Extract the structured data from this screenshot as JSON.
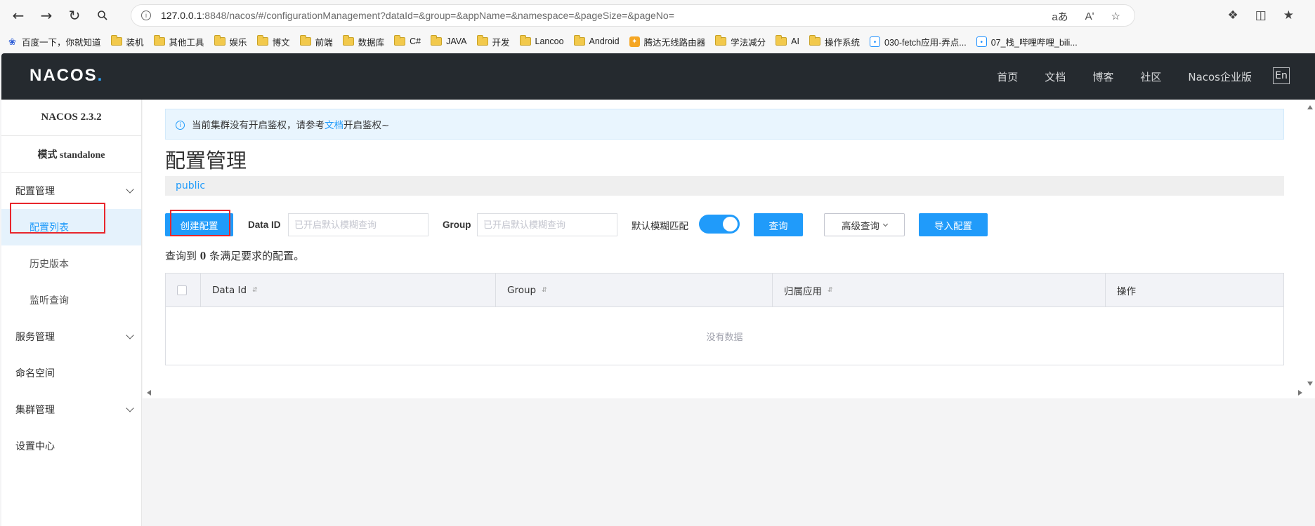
{
  "browser": {
    "url_prefix": "127.0.0.1",
    "url_rest": ":8848/nacos/#/configurationManagement?dataId=&group=&appName=&namespace=&pageSize=&pageNo=",
    "read_aloud": "aあ",
    "text_size": "Aʹ"
  },
  "bookmarks": [
    {
      "label": "百度一下，你就知道",
      "icon": "paw-icon"
    },
    {
      "label": "装机",
      "icon": "folder-icon"
    },
    {
      "label": "其他工具",
      "icon": "folder-icon"
    },
    {
      "label": "娱乐",
      "icon": "folder-icon"
    },
    {
      "label": "博文",
      "icon": "folder-icon"
    },
    {
      "label": "前端",
      "icon": "folder-icon"
    },
    {
      "label": "数据库",
      "icon": "folder-icon"
    },
    {
      "label": "C#",
      "icon": "folder-icon"
    },
    {
      "label": "JAVA",
      "icon": "folder-icon"
    },
    {
      "label": "开发",
      "icon": "folder-icon"
    },
    {
      "label": "Lancoo",
      "icon": "folder-icon"
    },
    {
      "label": "Android",
      "icon": "folder-icon"
    },
    {
      "label": "腾达无线路由器",
      "icon": "router-icon"
    },
    {
      "label": "学法减分",
      "icon": "folder-icon"
    },
    {
      "label": "AI",
      "icon": "folder-icon"
    },
    {
      "label": "操作系统",
      "icon": "folder-icon"
    },
    {
      "label": "030-fetch应用-弄点...",
      "icon": "bilibili-icon"
    },
    {
      "label": "07_栈_哔哩哔哩_bili...",
      "icon": "bilibili-icon"
    }
  ],
  "header": {
    "logo": "NACOS",
    "logo_dot": ".",
    "nav": [
      "首页",
      "文档",
      "博客",
      "社区",
      "Nacos企业版"
    ],
    "lang": "En"
  },
  "sidebar": {
    "version": "NACOS 2.3.2",
    "mode": "模式 standalone",
    "config_group": "配置管理",
    "config_list": "配置列表",
    "history": "历史版本",
    "listen": "监听查询",
    "service_group": "服务管理",
    "namespace": "命名空间",
    "cluster_group": "集群管理",
    "settings": "设置中心"
  },
  "alert": {
    "before": "当前集群没有开启鉴权，请参考",
    "link": "文档",
    "after": "开启鉴权~"
  },
  "page": {
    "title": "配置管理",
    "namespace": "public"
  },
  "toolbar": {
    "create": "创建配置",
    "dataid_label": "Data ID",
    "dataid_placeholder": "已开启默认模糊查询",
    "group_label": "Group",
    "group_placeholder": "已开启默认模糊查询",
    "fuzzy_label": "默认模糊匹配",
    "fuzzy_on": true,
    "query": "查询",
    "advanced": "高级查询",
    "import": "导入配置"
  },
  "result": {
    "before": "查询到",
    "count": "0",
    "after": "条满足要求的配置。"
  },
  "table": {
    "columns": [
      "Data Id",
      "Group",
      "归属应用",
      "操作"
    ],
    "sort_glyph": "⇵",
    "empty": "没有数据"
  },
  "colors": {
    "primary": "#209bfa",
    "header_bg": "#252a2f",
    "highlight": "#e8262d"
  }
}
